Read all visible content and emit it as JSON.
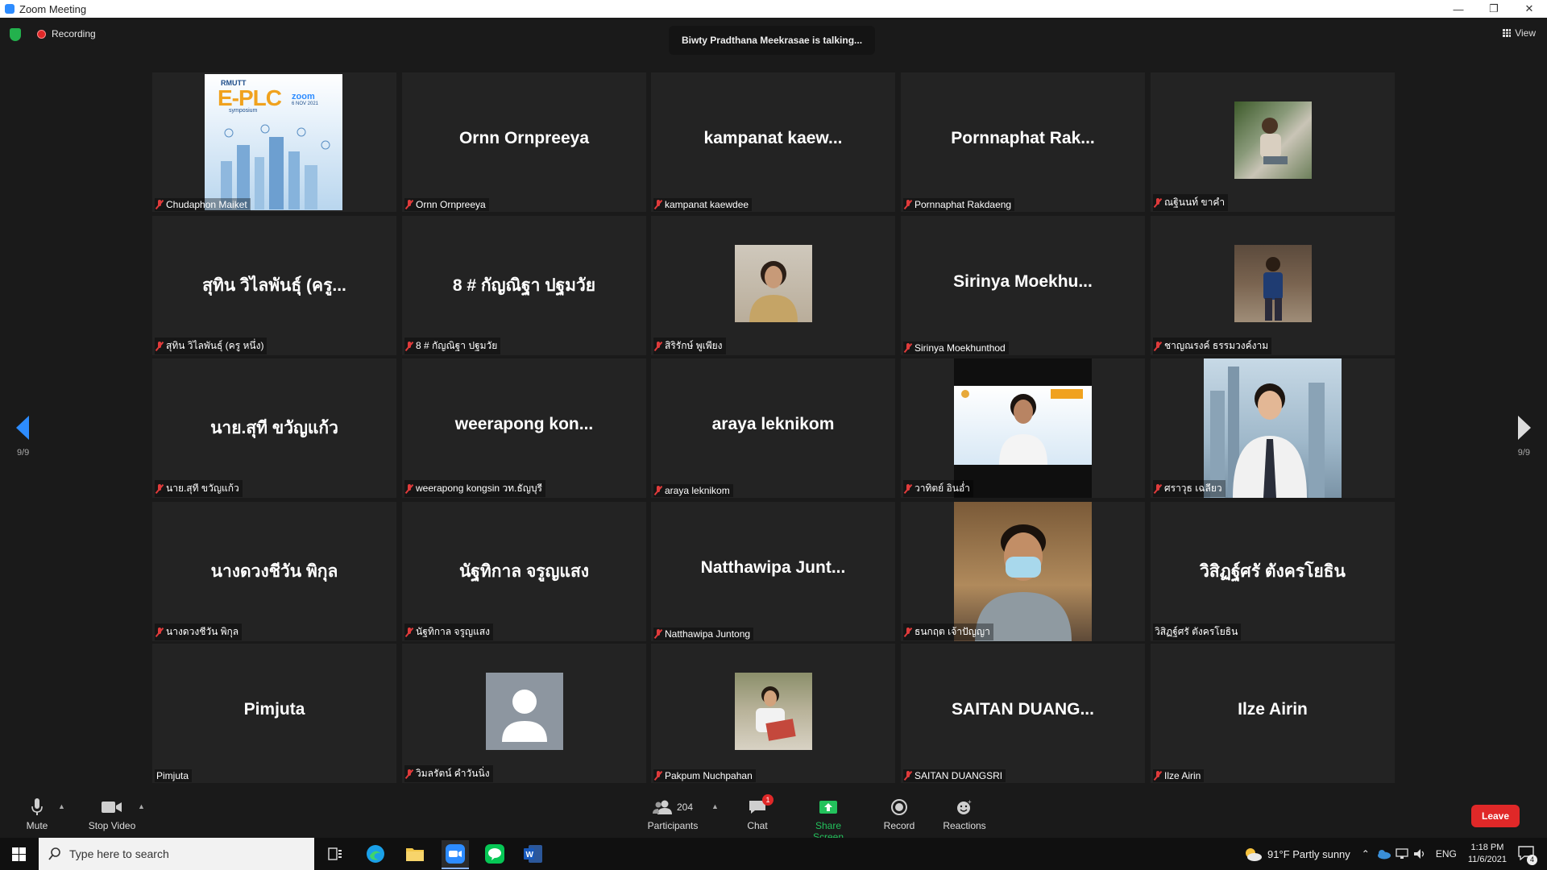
{
  "window": {
    "title": "Zoom Meeting",
    "minimize": "—",
    "restore": "❐",
    "close": "✕"
  },
  "topbar": {
    "recording": "Recording",
    "talking": "Biwty Pradthana Meekrasae is talking...",
    "view": "View"
  },
  "pagination": {
    "left": "9/9",
    "right": "9/9"
  },
  "tiles": [
    {
      "big": "",
      "label": "Chudaphon Maiket",
      "muted": true,
      "photo": "poster"
    },
    {
      "big": "Ornn Ornpreeya",
      "label": "Ornn Ornpreeya",
      "muted": true
    },
    {
      "big": "kampanat  kaew...",
      "label": "kampanat kaewdee",
      "muted": true
    },
    {
      "big": "Pornnaphat  Rak...",
      "label": "Pornnaphat Rakdaeng",
      "muted": true
    },
    {
      "big": "",
      "label": "ณฐินนท์ ขาคำ",
      "muted": true,
      "photo": "outdoor"
    },
    {
      "big": "สุทิน  วิไลพันธุ์ (ครู...",
      "label": "สุทิน วิไลพันธุ์ (ครู หนึ่ง)",
      "muted": true
    },
    {
      "big": "8 # กัญณิฐา ปฐมวัย",
      "label": "8 # กัญณิฐา ปฐมวัย",
      "muted": true
    },
    {
      "big": "",
      "label": "สิริรักษ์ พูเพียง",
      "muted": true,
      "photo": "uniform"
    },
    {
      "big": "Sirinya  Moekhu...",
      "label": "Sirinya Moekhunthod",
      "muted": true
    },
    {
      "big": "",
      "label": "ชาญณรงค์ ธรรมวงค์งาม",
      "muted": true,
      "photo": "standing"
    },
    {
      "big": "นาย.สุที ขวัญแก้ว",
      "label": "นาย.สุที ขวัญแก้ว",
      "muted": true
    },
    {
      "big": "weerapong   kon...",
      "label": "weerapong  kongsin  วท.ธัญบุรี",
      "muted": true
    },
    {
      "big": "araya leknikom",
      "label": "araya leknikom",
      "muted": true
    },
    {
      "big": "",
      "label": "วาทิตย์ อินอ่ำ",
      "muted": true,
      "photo": "webcam-poster"
    },
    {
      "big": "",
      "label": "ศราวุธ เฉลียว",
      "muted": true,
      "photo": "city"
    },
    {
      "big": "นางดวงชีวัน    พิกุล",
      "label": "นางดวงชีวัน   พิกุล",
      "muted": true
    },
    {
      "big": "นัฐทิกาล จรูญแสง",
      "label": "นัฐทิกาล จรูญแสง",
      "muted": true
    },
    {
      "big": "Natthawipa  Junt...",
      "label": "Natthawipa Juntong",
      "muted": true
    },
    {
      "big": "",
      "label": "ธนกฤต เจ้าปัญญา",
      "muted": true,
      "photo": "mask"
    },
    {
      "big": "วิสิฏฐ์ศรั  ตังครโยธิน",
      "label": "วิสิฏฐ์ศรั  ตังครโยธิน",
      "muted": false
    },
    {
      "big": "Pimjuta",
      "label": "Pimjuta",
      "muted": false
    },
    {
      "big": "",
      "label": "วิมลรัตน์ คำวันนิ่ง",
      "muted": true,
      "photo": "avatar"
    },
    {
      "big": "",
      "label": "Pakpum Nuchpahan",
      "muted": true,
      "photo": "reading"
    },
    {
      "big": "SAITAN  DUANG...",
      "label": "SAITAN DUANGSRI",
      "muted": true
    },
    {
      "big": "Ilze Airin",
      "label": "Ilze Airin",
      "muted": true
    }
  ],
  "poster": {
    "brand": "RMUTT",
    "title": "E-PLC",
    "zoom": "zoom",
    "date": "6 NOV 2021",
    "sub": "symposium"
  },
  "toolbar": {
    "mute": "Mute",
    "stop_video": "Stop Video",
    "participants": "Participants",
    "participants_count": "204",
    "chat": "Chat",
    "chat_badge": "1",
    "share": "Share Screen",
    "record": "Record",
    "reactions": "Reactions",
    "leave": "Leave"
  },
  "taskbar": {
    "search_placeholder": "Type here to search",
    "weather": "91°F  Partly sunny",
    "lang": "ENG",
    "time": "1:18 PM",
    "date": "11/6/2021",
    "notif": "4"
  },
  "colors": {
    "accent": "#2d8cff",
    "share": "#23c25c",
    "leave": "#e02828",
    "mute": "#e03b3b"
  }
}
